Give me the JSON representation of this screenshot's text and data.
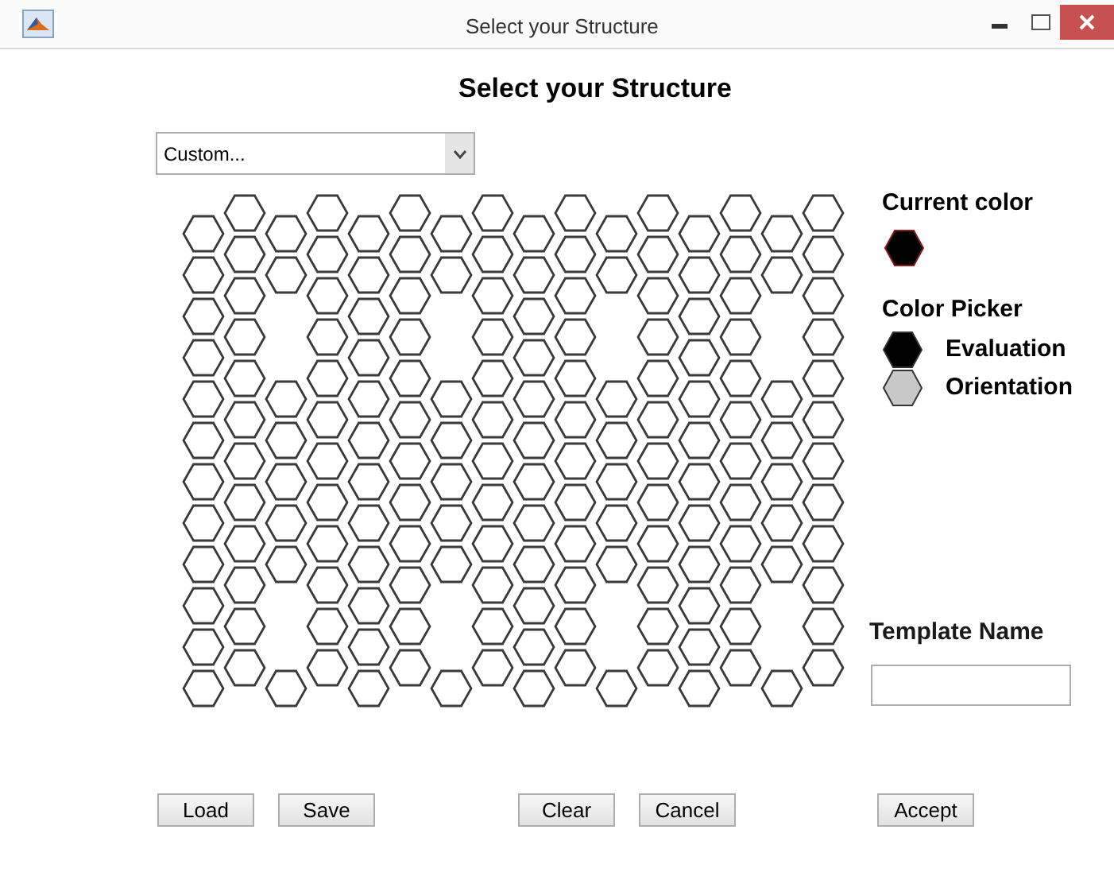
{
  "window": {
    "title": "Select your Structure"
  },
  "heading": "Select your Structure",
  "structure_dropdown": {
    "value": "Custom..."
  },
  "hex_grid": {
    "columns": [
      {
        "kind": "full"
      },
      {
        "kind": "full"
      },
      {
        "kind": "gapped"
      },
      {
        "kind": "full"
      },
      {
        "kind": "full"
      },
      {
        "kind": "full"
      },
      {
        "kind": "gapped"
      },
      {
        "kind": "full"
      },
      {
        "kind": "full"
      },
      {
        "kind": "full"
      },
      {
        "kind": "gapped"
      },
      {
        "kind": "full"
      },
      {
        "kind": "full"
      },
      {
        "kind": "full"
      },
      {
        "kind": "gapped"
      },
      {
        "kind": "full"
      }
    ]
  },
  "current_color": {
    "label": "Current color",
    "color": "#000000"
  },
  "color_picker": {
    "label": "Color Picker",
    "options": [
      {
        "label": "Evaluation",
        "color": "#000000"
      },
      {
        "label": "Orientation",
        "color": "#c8c8c8"
      }
    ]
  },
  "template_name": {
    "label": "Template Name"
  },
  "button_groups": [
    [
      "Load",
      "Save"
    ],
    [
      "Clear",
      "Cancel"
    ],
    [
      "Accept"
    ]
  ]
}
